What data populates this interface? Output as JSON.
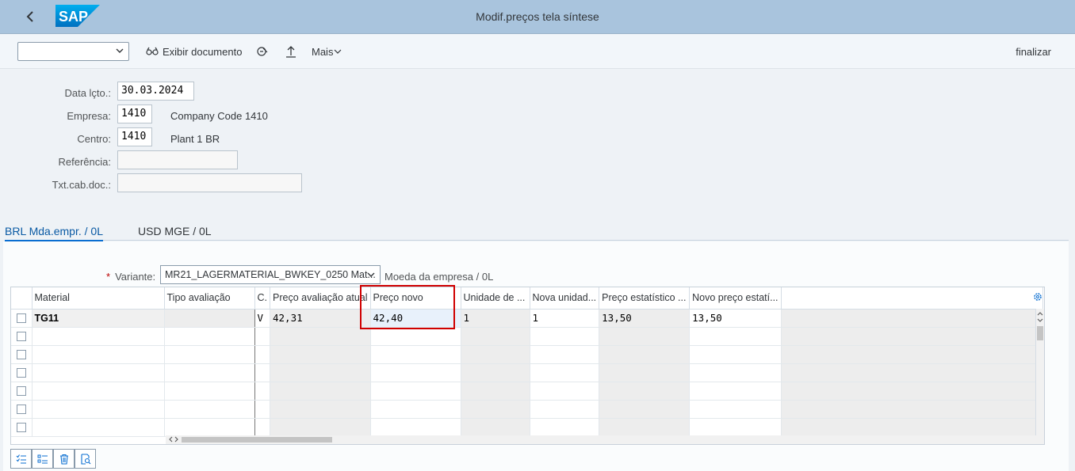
{
  "shell": {
    "title": "Modif.preços tela síntese",
    "logo_text": "SAP"
  },
  "toolbar": {
    "command_value": "",
    "display_document": "Exibir documento",
    "more": "Mais",
    "finish": "finalizar"
  },
  "form": {
    "date_label": "Data lçto.:",
    "date_value": "30.03.2024",
    "company_label": "Empresa:",
    "company_value": "1410",
    "company_desc": "Company Code 1410",
    "plant_label": "Centro:",
    "plant_value": "1410",
    "plant_desc": "Plant 1 BR",
    "reference_label": "Referência:",
    "reference_value": "",
    "header_text_label": "Txt.cab.doc.:",
    "header_text_value": ""
  },
  "tabs": [
    {
      "label": "BRL  Mda.empr. / 0L",
      "active": true
    },
    {
      "label": "USD  MGE / 0L",
      "active": false
    }
  ],
  "variant": {
    "label": "Variante:",
    "value": "MR21_LAGERMATERIAL_BWKEY_0250 Mat...",
    "description": "Moeda da empresa / 0L"
  },
  "grid": {
    "columns": [
      "Material",
      "Tipo avaliação",
      "C.",
      "Preço avaliação atual",
      "Preço novo",
      "Unidade de ...",
      "Nova unidad...",
      "Preço estatístico ...",
      "Novo preço estatí..."
    ],
    "rows": [
      [
        "TG11",
        "",
        "V",
        "42,31",
        "42,40",
        "1",
        "1",
        "13,50",
        "13,50"
      ]
    ]
  },
  "colors": {
    "shell_bg": "#a9c4dd",
    "accent": "#0a6ed1",
    "focus_highlight": "#d00000"
  }
}
